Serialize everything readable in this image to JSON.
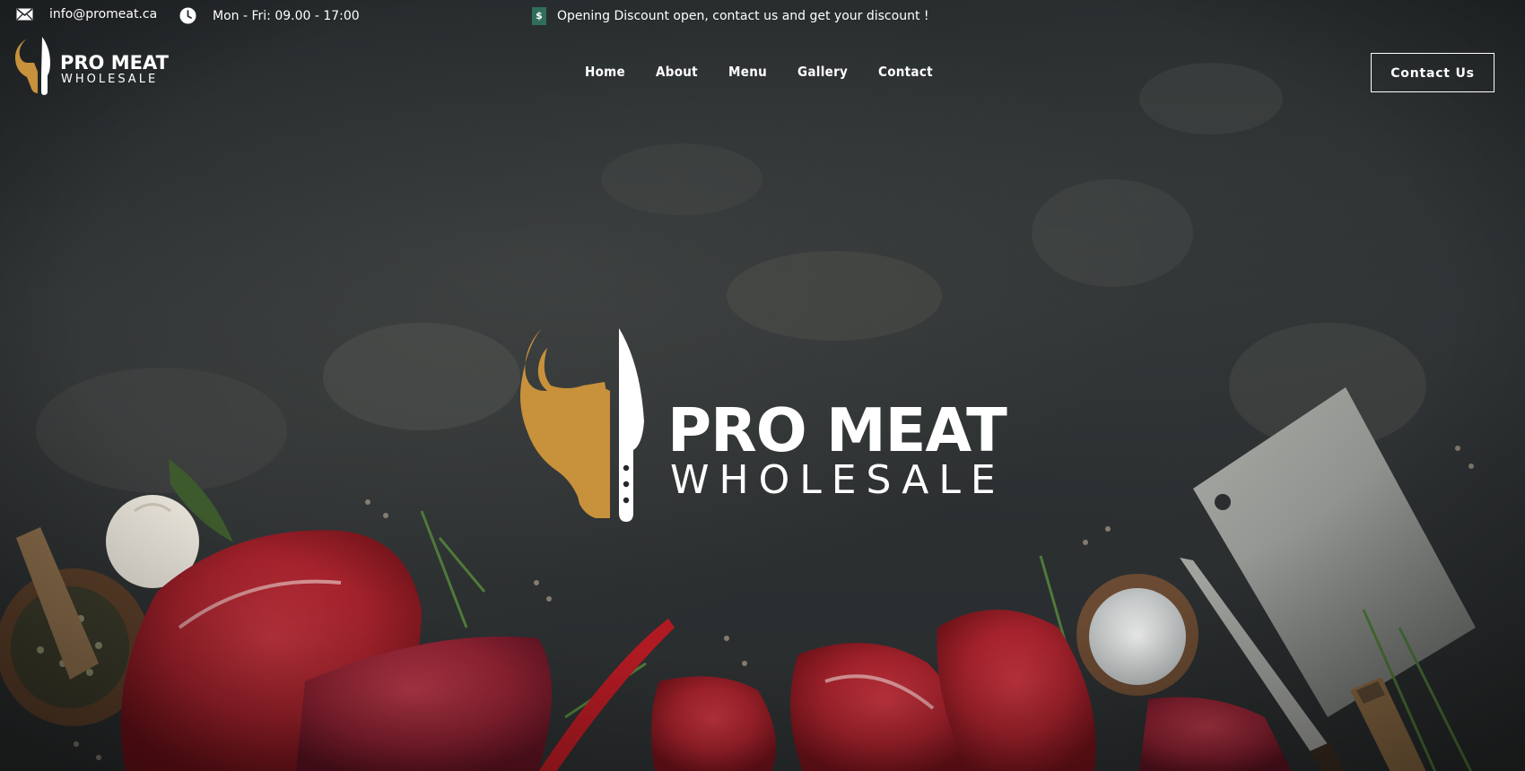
{
  "topbar": {
    "email": "info@promeat.ca",
    "email_icon": "envelope-icon",
    "hours": "Mon - Fri: 09.00 - 17:00",
    "hours_icon": "clock-icon",
    "announcement_badge": "$",
    "announcement": "Opening Discount open, contact us and get your discount !"
  },
  "brand": {
    "name": "PRO MEAT",
    "tagline": "WHOLESALE",
    "logo_icon": "bull-head-knife-icon",
    "accent_color": "#C8913B"
  },
  "nav": {
    "items": [
      {
        "label": "Home"
      },
      {
        "label": "About"
      },
      {
        "label": "Menu"
      },
      {
        "label": "Gallery"
      },
      {
        "label": "Contact"
      }
    ],
    "cta_label": "Contact Us"
  },
  "hero": {
    "logo_name": "PRO MEAT",
    "logo_tagline": "WHOLESALE",
    "background": "dark-slate-with-raw-meat-and-cleaver"
  }
}
